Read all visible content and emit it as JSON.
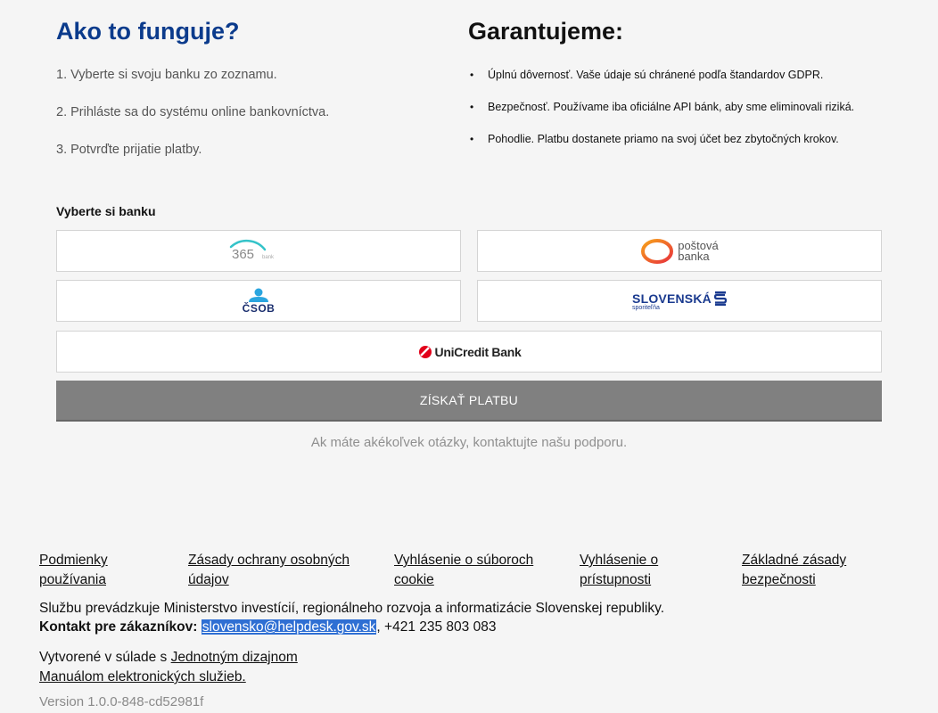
{
  "how": {
    "title": "Ako to funguje?",
    "steps": [
      "1. Vyberte si svoju banku zo zoznamu.",
      "2. Prihláste sa do systému online bankovníctva.",
      "3. Potvrďte prijatie platby."
    ]
  },
  "guarantee": {
    "title": "Garantujeme:",
    "items": [
      "Úplnú dôvernosť. Vaše údaje sú chránené podľa štandardov GDPR.",
      "Bezpečnosť. Používame iba oficiálne API bánk, aby sme eliminovali riziká.",
      "Pohodlie. Platbu dostanete priamo na svoj účet bez zbytočných krokov."
    ]
  },
  "banks": {
    "heading": "Vyberte si banku",
    "b365": {
      "num": "365",
      "sub": "bank"
    },
    "postova": {
      "line1": "poštová",
      "line2": "banka"
    },
    "csob": {
      "name": "ČSOB"
    },
    "slsp": {
      "name": "SLOVENSKÁ",
      "sub": "sporiteľňa"
    },
    "unicredit": {
      "name": "UniCredit Bank"
    }
  },
  "action": {
    "button": "ZÍSKAŤ PLATBU",
    "support": "Ak máte akékoľvek otázky, kontaktujte našu podporu."
  },
  "footer": {
    "links": [
      "Podmienky používania",
      "Zásady ochrany osobných údajov",
      "Vyhlásenie o súboroch cookie",
      "Vyhlásenie o prístupnosti",
      "Základné zásady bezpečnosti"
    ],
    "operated_by": "Službu prevádzkuje Ministerstvo investícií, regionálneho rozvoja a informatizácie Slovenskej republiky.",
    "contact_label": "Kontakt pre zákazníkov:",
    "contact_email": "slovensko@helpdesk.gov.sk",
    "contact_phone": ", +421 235 803 083",
    "made_prefix": "Vytvorené v súlade s ",
    "made_link": "Jednotným dizajnom Manuálom elektronických služieb.",
    "version": "Version 1.0.0-848-cd52981f"
  },
  "colors": {
    "heading_blue": "#0b3b8c",
    "button_gray": "#808080",
    "email_highlight": "#2f6fd3"
  }
}
